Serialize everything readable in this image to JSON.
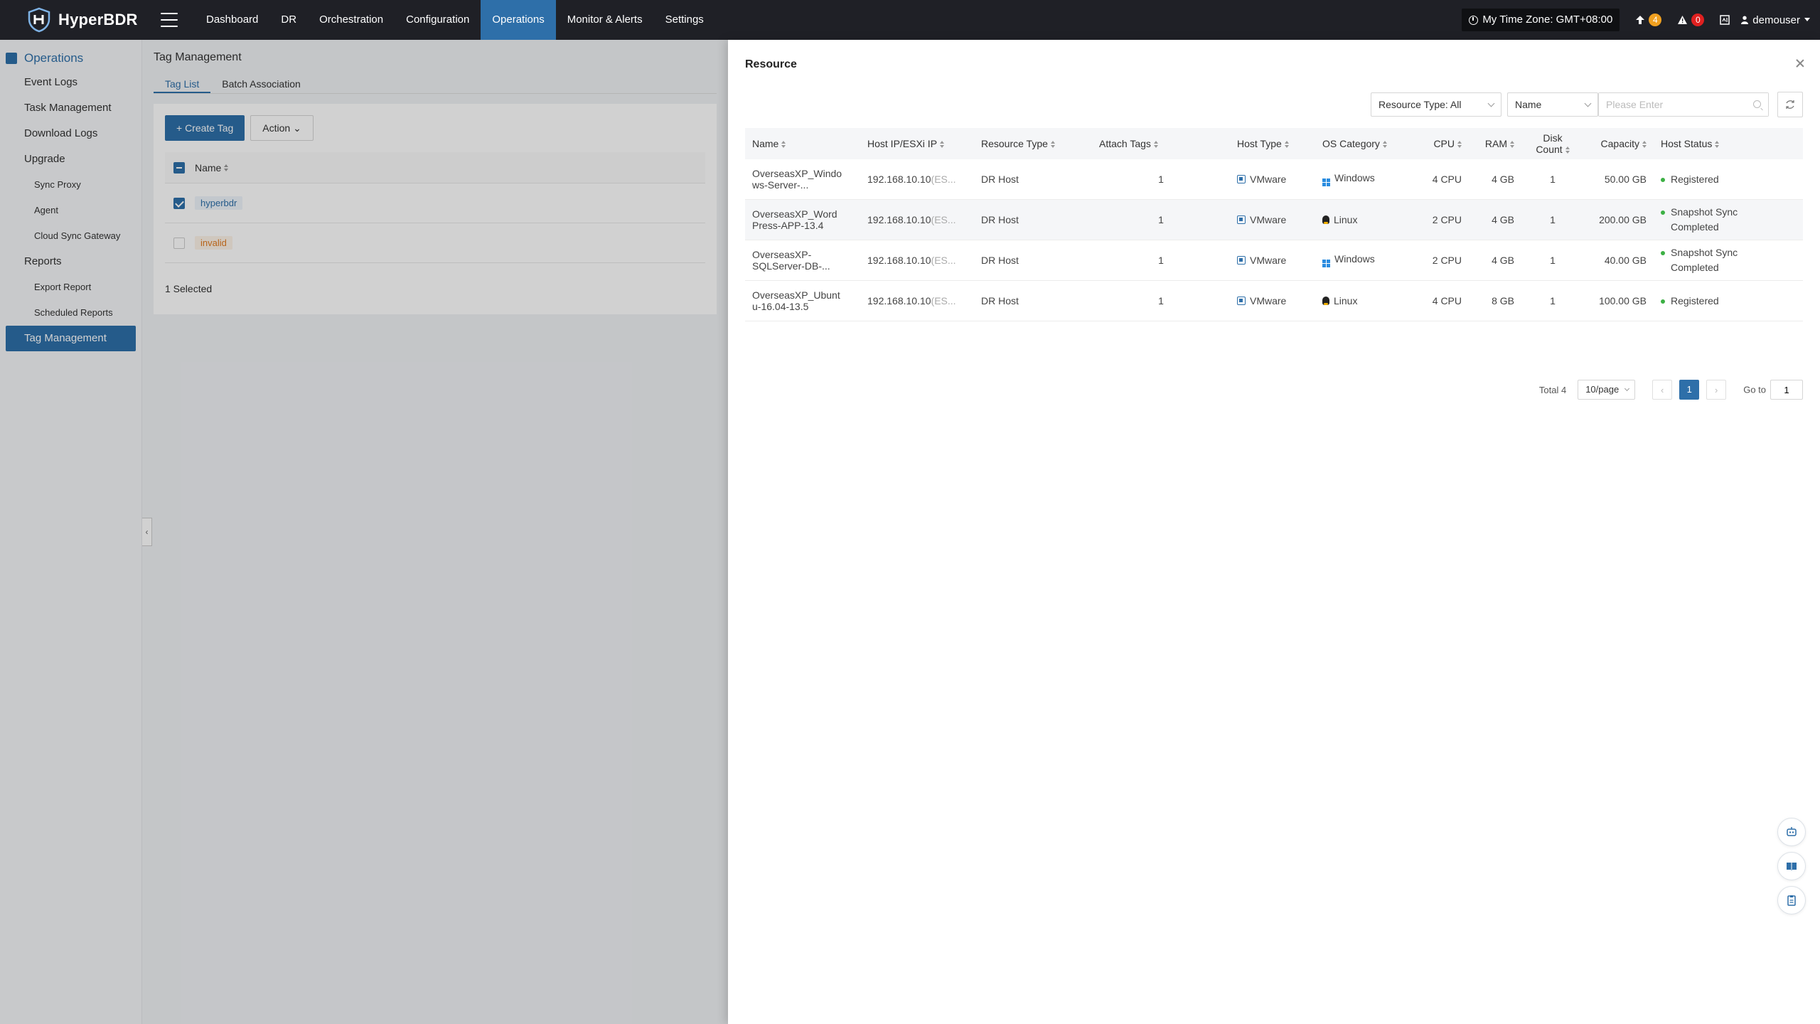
{
  "app": {
    "name": "HyperBDR"
  },
  "nav": {
    "items": [
      {
        "label": "Dashboard"
      },
      {
        "label": "DR"
      },
      {
        "label": "Orchestration"
      },
      {
        "label": "Configuration"
      },
      {
        "label": "Operations"
      },
      {
        "label": "Monitor & Alerts"
      },
      {
        "label": "Settings"
      }
    ],
    "active": "Operations",
    "timezone": "My Time Zone: GMT+08:00",
    "upgrade_count": "4",
    "alert_count": "0",
    "user": "demouser"
  },
  "sidebar": {
    "title": "Operations",
    "items": [
      {
        "label": "Event Logs"
      },
      {
        "label": "Task Management"
      },
      {
        "label": "Download Logs"
      },
      {
        "label": "Upgrade"
      },
      {
        "label": "Sync Proxy"
      },
      {
        "label": "Agent"
      },
      {
        "label": "Cloud Sync Gateway"
      },
      {
        "label": "Reports"
      },
      {
        "label": "Export Report"
      },
      {
        "label": "Scheduled Reports"
      },
      {
        "label": "Tag Management"
      }
    ]
  },
  "main": {
    "title": "Tag Management",
    "tabs": [
      "Tag List",
      "Batch Association"
    ],
    "create_label": "+ Create Tag",
    "action_label": "Action",
    "name_header": "Name",
    "tags": [
      "hyperbdr",
      "invalid"
    ],
    "selected": "1 Selected"
  },
  "drawer": {
    "title": "Resource",
    "filter_type": "Resource Type: All",
    "filter_field": "Name",
    "search_placeholder": "Please Enter",
    "headers": [
      "Name",
      "Host IP/ESXi IP",
      "Resource Type",
      "Attach Tags",
      "Host Type",
      "OS Category",
      "CPU",
      "RAM",
      "Disk Count",
      "Capacity",
      "Host Status"
    ],
    "rows": [
      {
        "name1": "OverseasXP_Windo",
        "name2": "ws-Server-...",
        "ip": "192.168.10.10",
        "ip_suffix": "(ES...",
        "rtype": "DR Host",
        "tags": "1",
        "htype": "VMware",
        "os": "Windows",
        "cpu": "4 CPU",
        "ram": "4 GB",
        "disks": "1",
        "cap": "50.00 GB",
        "status1": "Registered",
        "status2": ""
      },
      {
        "name1": "OverseasXP_Word",
        "name2": "Press-APP-13.4",
        "ip": "192.168.10.10",
        "ip_suffix": "(ES...",
        "rtype": "DR Host",
        "tags": "1",
        "htype": "VMware",
        "os": "Linux",
        "cpu": "2 CPU",
        "ram": "4 GB",
        "disks": "1",
        "cap": "200.00 GB",
        "status1": "Snapshot Sync",
        "status2": "Completed"
      },
      {
        "name1": "OverseasXP-",
        "name2": "SQLServer-DB-...",
        "ip": "192.168.10.10",
        "ip_suffix": "(ES...",
        "rtype": "DR Host",
        "tags": "1",
        "htype": "VMware",
        "os": "Windows",
        "cpu": "2 CPU",
        "ram": "4 GB",
        "disks": "1",
        "cap": "40.00 GB",
        "status1": "Snapshot Sync",
        "status2": "Completed"
      },
      {
        "name1": "OverseasXP_Ubunt",
        "name2": "u-16.04-13.5",
        "ip": "192.168.10.10",
        "ip_suffix": "(ES...",
        "rtype": "DR Host",
        "tags": "1",
        "htype": "VMware",
        "os": "Linux",
        "cpu": "4 CPU",
        "ram": "8 GB",
        "disks": "1",
        "cap": "100.00 GB",
        "status1": "Registered",
        "status2": ""
      }
    ],
    "pager": {
      "total": "Total 4",
      "size": "10/page",
      "page": "1",
      "goto_label": "Go to",
      "goto_value": "1"
    }
  },
  "colors": {
    "primary": "#2e6fa9",
    "topbar": "#1f2026",
    "success": "#3cb044"
  }
}
